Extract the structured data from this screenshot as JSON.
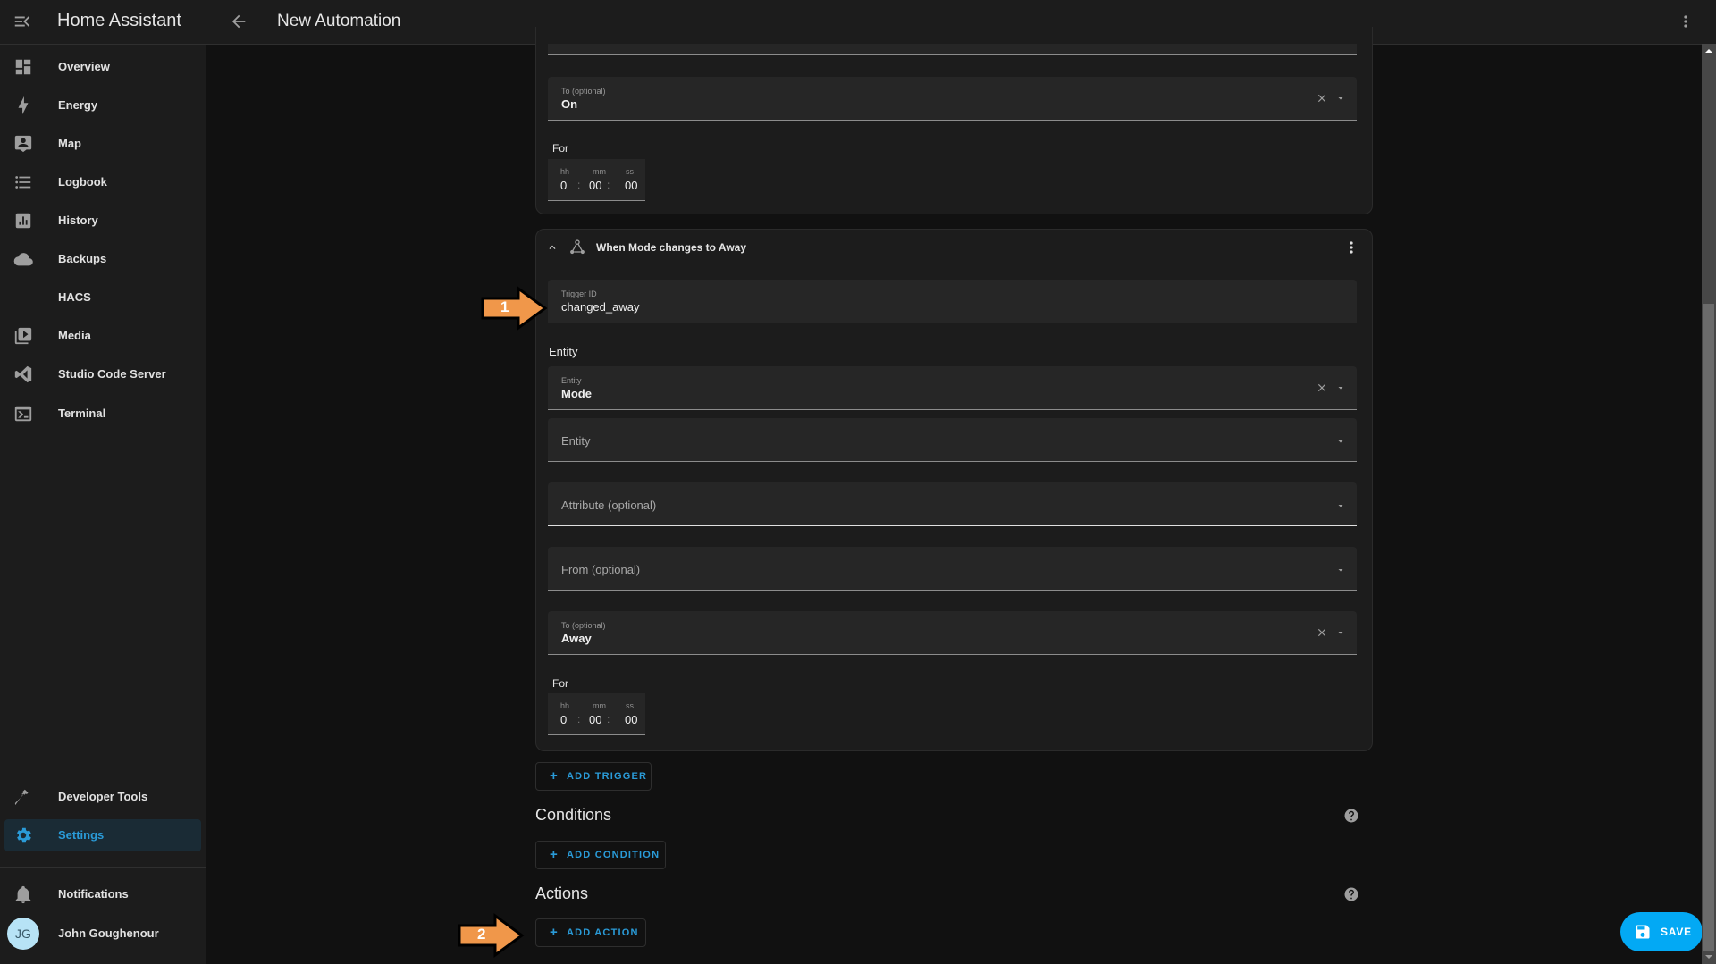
{
  "app": {
    "title": "Home Assistant"
  },
  "header": {
    "title": "New Automation"
  },
  "sidebar": {
    "items": [
      {
        "label": "Overview",
        "icon": "view-dashboard-icon"
      },
      {
        "label": "Energy",
        "icon": "lightning-bolt-icon"
      },
      {
        "label": "Map",
        "icon": "map-account-icon"
      },
      {
        "label": "Logbook",
        "icon": "format-list-bulleted-icon"
      },
      {
        "label": "History",
        "icon": "chart-box-icon"
      },
      {
        "label": "Backups",
        "icon": "cloud-icon"
      },
      {
        "label": "HACS",
        "icon": ""
      },
      {
        "label": "Media",
        "icon": "play-box-multiple-icon"
      },
      {
        "label": "Studio Code Server",
        "icon": "vscode-icon"
      },
      {
        "label": "Terminal",
        "icon": "console-icon"
      }
    ],
    "developer_tools": "Developer Tools",
    "settings": "Settings",
    "notifications": "Notifications",
    "user": {
      "name": "John Goughenour",
      "initials": "JG"
    }
  },
  "trigger1": {
    "to_label": "To (optional)",
    "to_value": "On",
    "for_label": "For",
    "duration": {
      "hh_label": "hh",
      "mm_label": "mm",
      "ss_label": "ss",
      "hh": "0",
      "mm": "00",
      "ss": "00"
    }
  },
  "trigger2": {
    "title": "When Mode changes to Away",
    "trigger_id_label": "Trigger ID",
    "trigger_id_value": "changed_away",
    "entity_section_label": "Entity",
    "entity_label": "Entity",
    "entity_value": "Mode",
    "entity_placeholder": "Entity",
    "attribute_placeholder": "Attribute (optional)",
    "from_placeholder": "From (optional)",
    "to_label": "To (optional)",
    "to_value": "Away",
    "for_label": "For",
    "duration": {
      "hh_label": "hh",
      "mm_label": "mm",
      "ss_label": "ss",
      "hh": "0",
      "mm": "00",
      "ss": "00"
    }
  },
  "buttons": {
    "add_trigger": "ADD TRIGGER",
    "add_condition": "ADD CONDITION",
    "add_action": "ADD ACTION",
    "save": "SAVE"
  },
  "sections": {
    "conditions": "Conditions",
    "actions": "Actions"
  },
  "annotations": [
    {
      "number": "1"
    },
    {
      "number": "2"
    }
  ],
  "colors": {
    "accent": "#03a9f4",
    "link": "#2a9bd8",
    "annotation": "#f0974a"
  }
}
